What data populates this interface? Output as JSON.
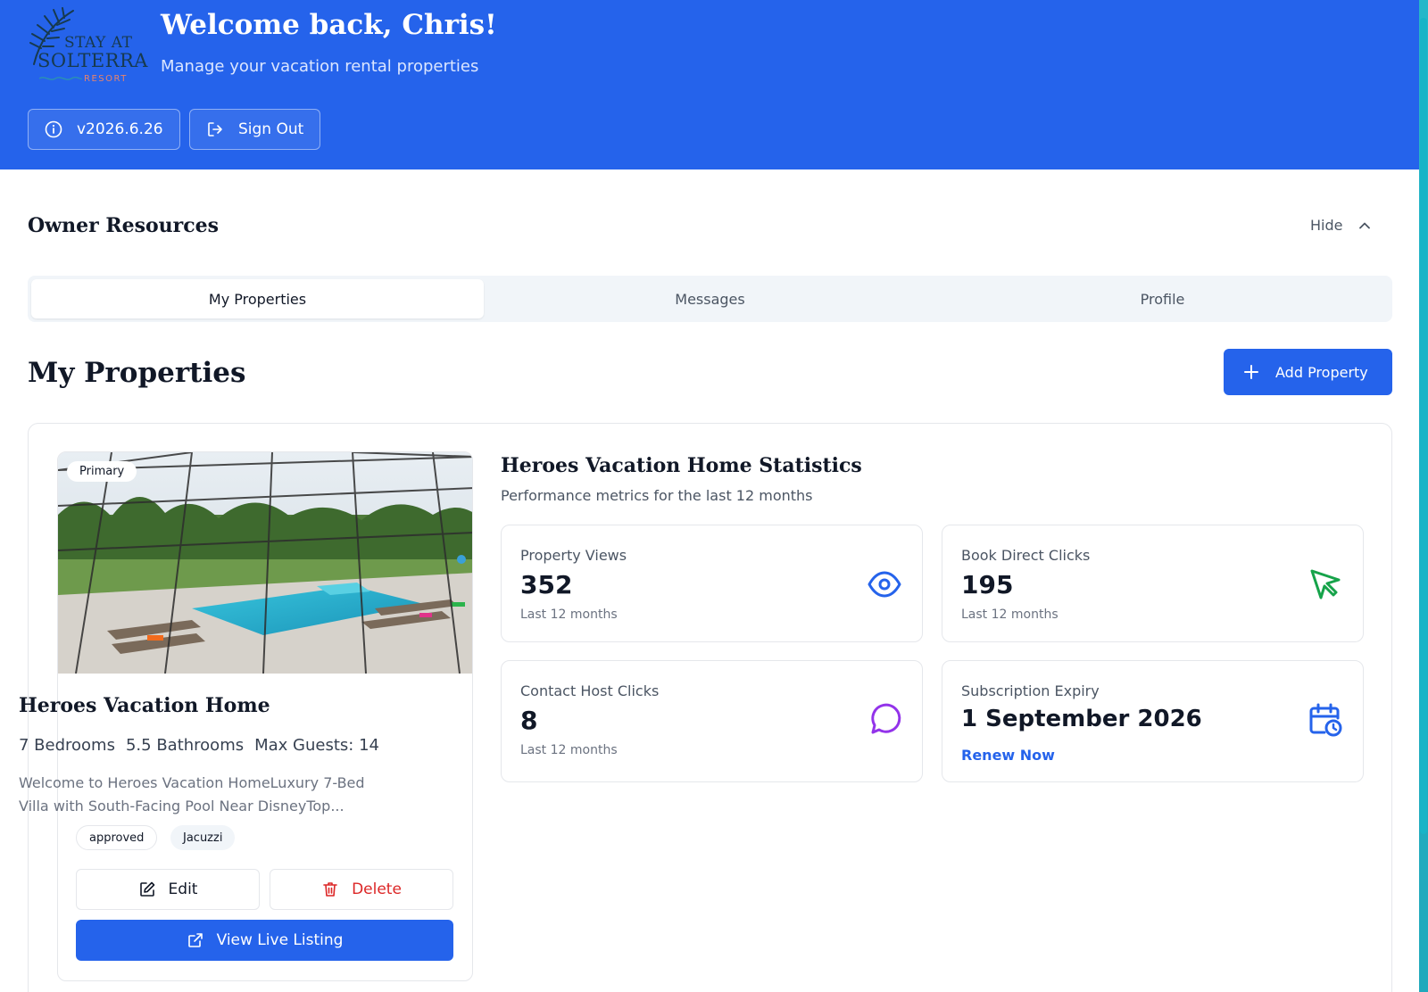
{
  "header": {
    "logo": {
      "line1": "STAY AT",
      "line2": "SOLTERRA",
      "line3": "RESORT"
    },
    "welcome": "Welcome back, Chris!",
    "subtitle": "Manage your vacation rental properties",
    "version_label": "v2026.6.26",
    "signout_label": "Sign Out",
    "info_icon": "info-icon",
    "signout_icon": "sign-out-icon"
  },
  "resources": {
    "title": "Owner Resources",
    "hide_label": "Hide",
    "hide_icon": "chevron-up-icon",
    "tabs": [
      {
        "label": "My Properties",
        "active": true
      },
      {
        "label": "Messages",
        "active": false
      },
      {
        "label": "Profile",
        "active": false
      }
    ]
  },
  "properties": {
    "title": "My Properties",
    "add_label": "Add Property",
    "add_icon": "plus-icon"
  },
  "property": {
    "badge": "Primary",
    "name": "Heroes Vacation Home",
    "bedrooms": "7 Bedrooms",
    "bathrooms": "5.5 Bathrooms",
    "guests": "Max Guests: 14",
    "description": "Welcome to Heroes Vacation HomeLuxury 7-Bed Villa with South-Facing Pool Near DisneyTop...",
    "tags": [
      "approved",
      "Jacuzzi"
    ],
    "edit_label": "Edit",
    "delete_label": "Delete",
    "view_label": "View Live Listing"
  },
  "stats": {
    "title": "Heroes Vacation Home Statistics",
    "subtitle": "Performance metrics for the last 12 months",
    "cards": [
      {
        "label": "Property Views",
        "value": "352",
        "note": "Last 12 months",
        "icon": "eye-icon",
        "color": "#2563eb"
      },
      {
        "label": "Book Direct Clicks",
        "value": "195",
        "note": "Last 12 months",
        "icon": "cursor-icon",
        "color": "#16a34a"
      },
      {
        "label": "Contact Host Clicks",
        "value": "8",
        "note": "Last 12 months",
        "icon": "message-icon",
        "color": "#9333ea"
      },
      {
        "label": "Subscription Expiry",
        "value": "1 September 2026",
        "link": "Renew Now",
        "icon": "calendar-clock-icon",
        "color": "#2563eb"
      }
    ]
  },
  "colors": {
    "brand": "#2563eb",
    "danger": "#dc2626"
  }
}
